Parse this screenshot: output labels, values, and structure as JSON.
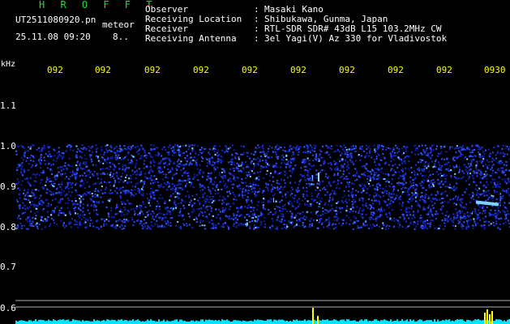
{
  "header": {
    "app_title": "H R O F F T",
    "filename": "UT2511080920.pn",
    "meteor_label": "meteor",
    "datetime": "25.11.08 09:20",
    "count": "8.."
  },
  "station": [
    {
      "key": "Observer",
      "value": "Masaki Kano"
    },
    {
      "key": "Receiving Location",
      "value": "Shibukawa, Gunma, Japan"
    },
    {
      "key": "Receiver",
      "value": "RTL-SDR SDR# 43dB L15 103.2MHz CW"
    },
    {
      "key": "Receiving Antenna",
      "value": "3el Yagi(V) Az 330 for Vladivostok"
    }
  ],
  "separator": ":",
  "axis": {
    "y_unit": "kHz",
    "y_ticks": [
      "1.1",
      "1.0",
      "0.9",
      "0.8",
      "0.7",
      "0.6"
    ],
    "x_ticks": [
      "092",
      "092",
      "092",
      "092",
      "092",
      "092",
      "092",
      "092",
      "092",
      "0930"
    ]
  },
  "colors": {
    "noise_band": "#1a2ed8",
    "noise_hot": "#7fd0ff",
    "gridline": "#b0b0b0",
    "spectrum_trace": "#00e5ff",
    "spectrum_spike": "#ffff00",
    "title_green": "#18e03a",
    "tick_yellow": "#ffff00"
  }
}
